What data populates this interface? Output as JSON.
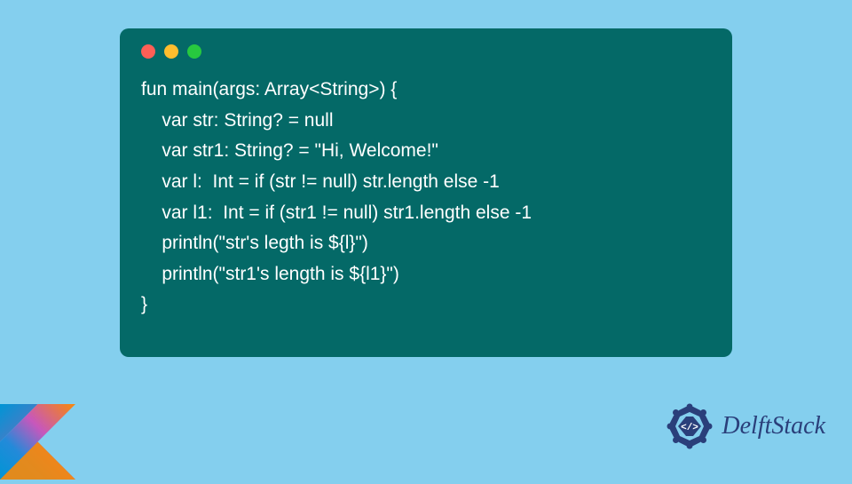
{
  "code": {
    "lines": [
      "fun main(args: Array<String>) {",
      "    var str: String? = null",
      "    var str1: String? = \"Hi, Welcome!\"",
      "    var l:  Int = if (str != null) str.length else -1",
      "    var l1:  Int = if (str1 != null) str1.length else -1",
      "    println(\"str's legth is ${l}\")",
      "    println(\"str1's length is ${l1}\")",
      "}"
    ]
  },
  "branding": {
    "text": "DelftStack"
  },
  "colors": {
    "background": "#84cfee",
    "window": "#046967",
    "red": "#ff5f56",
    "yellow": "#ffbd2e",
    "green": "#27c93f",
    "brand": "#2a3f7a"
  }
}
